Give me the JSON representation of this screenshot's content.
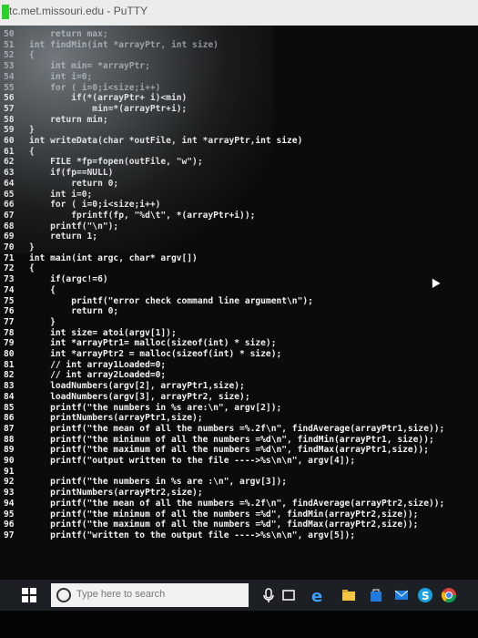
{
  "window": {
    "title": "tc.met.missouri.edu - PuTTY"
  },
  "code_lines": [
    {
      "no": "50",
      "text": "    return max;",
      "dim": true
    },
    {
      "no": "51",
      "text": "int findMin(int *arrayPtr, int size)",
      "dim": true
    },
    {
      "no": "52",
      "text": "{",
      "dim": true
    },
    {
      "no": "53",
      "text": "    int min= *arrayPtr;",
      "dim": true
    },
    {
      "no": "54",
      "text": "    int i=0;",
      "dim": true
    },
    {
      "no": "55",
      "text": "    for ( i=0;i<size;i++)",
      "dim": true
    },
    {
      "no": "56",
      "text": "        if(*(arrayPtr+ i)<min)",
      "dim": false
    },
    {
      "no": "57",
      "text": "            min=*(arrayPtr+i);",
      "dim": false
    },
    {
      "no": "58",
      "text": "    return min;",
      "dim": false
    },
    {
      "no": "59",
      "text": "}",
      "dim": false
    },
    {
      "no": "60",
      "text": "int writeData(char *outFile, int *arrayPtr,int size)",
      "dim": false
    },
    {
      "no": "61",
      "text": "{",
      "dim": false
    },
    {
      "no": "62",
      "text": "    FILE *fp=fopen(outFile, \"w\");",
      "dim": false
    },
    {
      "no": "63",
      "text": "    if(fp==NULL)",
      "dim": false
    },
    {
      "no": "64",
      "text": "        return 0;",
      "dim": false
    },
    {
      "no": "65",
      "text": "    int i=0;",
      "dim": false
    },
    {
      "no": "66",
      "text": "    for ( i=0;i<size;i++)",
      "dim": false
    },
    {
      "no": "67",
      "text": "        fprintf(fp, \"%d\\t\", *(arrayPtr+i));",
      "dim": false
    },
    {
      "no": "68",
      "text": "    printf(\"\\n\");",
      "dim": false
    },
    {
      "no": "69",
      "text": "    return 1;",
      "dim": false
    },
    {
      "no": "70",
      "text": "}",
      "dim": false
    },
    {
      "no": "71",
      "text": "int main(int argc, char* argv[])",
      "dim": false
    },
    {
      "no": "72",
      "text": "{",
      "dim": false
    },
    {
      "no": "73",
      "text": "    if(argc!=6)",
      "dim": false
    },
    {
      "no": "74",
      "text": "    {",
      "dim": false
    },
    {
      "no": "75",
      "text": "        printf(\"error check command line argument\\n\");",
      "dim": false
    },
    {
      "no": "76",
      "text": "        return 0;",
      "dim": false
    },
    {
      "no": "77",
      "text": "    }",
      "dim": false
    },
    {
      "no": "78",
      "text": "    int size= atoi(argv[1]);",
      "dim": false
    },
    {
      "no": "79",
      "text": "    int *arrayPtr1= malloc(sizeof(int) * size);",
      "dim": false
    },
    {
      "no": "80",
      "text": "    int *arrayPtr2 = malloc(sizeof(int) * size);",
      "dim": false
    },
    {
      "no": "81",
      "text": "    // int array1Loaded=0;",
      "dim": false
    },
    {
      "no": "82",
      "text": "    // int array2Loaded=0;",
      "dim": false
    },
    {
      "no": "83",
      "text": "    loadNumbers(argv[2], arrayPtr1,size);",
      "dim": false
    },
    {
      "no": "84",
      "text": "    loadNumbers(argv[3], arrayPtr2, size);",
      "dim": false
    },
    {
      "no": "85",
      "text": "    printf(\"the numbers in %s are:\\n\", argv[2]);",
      "dim": false
    },
    {
      "no": "86",
      "text": "    printNumbers(arrayPtr1,size);",
      "dim": false
    },
    {
      "no": "87",
      "text": "    printf(\"the mean of all the numbers =%.2f\\n\", findAverage(arrayPtr1,size));",
      "dim": false
    },
    {
      "no": "88",
      "text": "    printf(\"the minimum of all the numbers =%d\\n\", findMin(arrayPtr1, size));",
      "dim": false
    },
    {
      "no": "89",
      "text": "    printf(\"the maximum of all the numbers =%d\\n\", findMax(arrayPtr1,size));",
      "dim": false
    },
    {
      "no": "90",
      "text": "    printf(\"output written to the file ---->%s\\n\\n\", argv[4]);",
      "dim": false
    },
    {
      "no": "91",
      "text": "",
      "dim": false
    },
    {
      "no": "92",
      "text": "    printf(\"the numbers in %s are :\\n\", argv[3]);",
      "dim": false
    },
    {
      "no": "93",
      "text": "    printNumbers(arrayPtr2,size);",
      "dim": false
    },
    {
      "no": "94",
      "text": "    printf(\"the mean of all the numbers =%.2f\\n\", findAverage(arrayPtr2,size));",
      "dim": false
    },
    {
      "no": "95",
      "text": "    printf(\"the minimum of all the numbers =%d\", findMin(arrayPtr2,size));",
      "dim": false
    },
    {
      "no": "96",
      "text": "    printf(\"the maximum of all the numbers =%d\", findMax(arrayPtr2,size));",
      "dim": false
    },
    {
      "no": "97",
      "text": "    printf(\"written to the output file ---->%s\\n\\n\", argv[5]);",
      "dim": false
    }
  ],
  "taskbar": {
    "search_placeholder": "Type here to search",
    "icons": [
      "windows-start-icon",
      "microphone-icon",
      "task-view-icon",
      "edge-icon",
      "file-explorer-icon",
      "store-icon",
      "mail-icon",
      "skype-icon",
      "chrome-icon"
    ]
  }
}
